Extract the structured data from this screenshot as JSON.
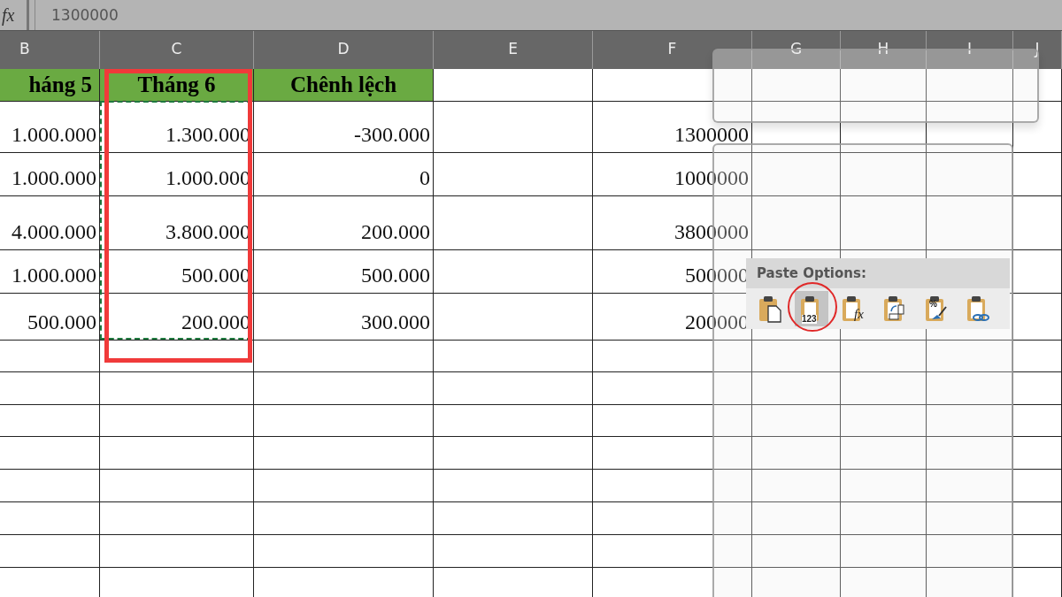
{
  "formula_bar": {
    "fx": "fx",
    "value": "1300000"
  },
  "columns": [
    {
      "label": "B"
    },
    {
      "label": "C"
    },
    {
      "label": "D"
    },
    {
      "label": "E"
    },
    {
      "label": "F"
    },
    {
      "label": "G"
    },
    {
      "label": "H"
    },
    {
      "label": "I"
    },
    {
      "label": "J"
    }
  ],
  "header_row": {
    "b": "háng 5",
    "c": "Tháng 6",
    "d": "Chênh lệch"
  },
  "rows": [
    {
      "b": "1.000.000",
      "c": "1.300.000",
      "d": "-300.000",
      "f": "1300000"
    },
    {
      "b": "1.000.000",
      "c": "1.000.000",
      "d": "0",
      "f": "1000000"
    },
    {
      "b": "4.000.000",
      "c": "3.800.000",
      "d": "200.000",
      "f": "3800000"
    },
    {
      "b": "1.000.000",
      "c": "500.000",
      "d": "500.000",
      "f": "500000"
    },
    {
      "b": "500.000",
      "c": "200.000",
      "d": "300.000",
      "f": "200000"
    }
  ],
  "paste_options": {
    "title": "Paste Options:",
    "items": [
      {
        "kind": "paste",
        "selected": false
      },
      {
        "kind": "values",
        "label": "123",
        "selected": true
      },
      {
        "kind": "formulas",
        "label": "fx",
        "selected": false
      },
      {
        "kind": "transpose",
        "selected": false
      },
      {
        "kind": "formatting",
        "label": "%",
        "selected": false
      },
      {
        "kind": "link",
        "selected": false
      }
    ]
  }
}
